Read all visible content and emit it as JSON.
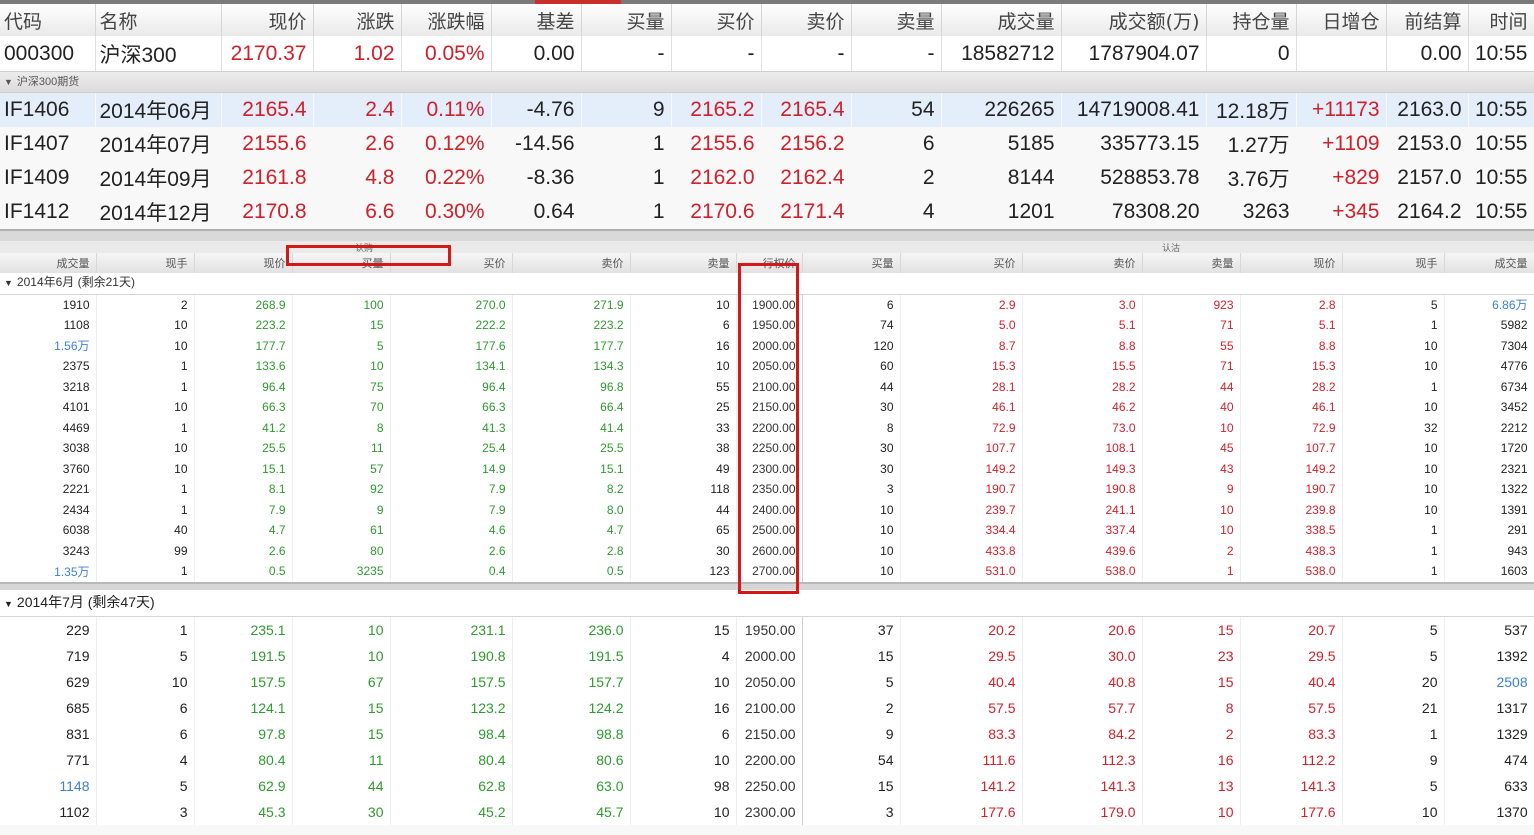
{
  "index_table": {
    "headers": [
      "代码",
      "名称",
      "现价",
      "涨跌",
      "涨跌幅",
      "基差",
      "买量",
      "买价",
      "卖价",
      "卖量",
      "成交量",
      "成交额(万)",
      "持仓量",
      "日增仓",
      "前结算",
      "时间"
    ],
    "row": [
      "000300",
      "沪深300",
      "2170.37",
      "1.02",
      "0.05%",
      "0.00",
      "-",
      "-",
      "-",
      "-",
      "18582712",
      "1787904.07",
      "0",
      "",
      "0.00",
      "10:55"
    ]
  },
  "futures_group_label": "沪深300期货",
  "futures": [
    [
      "IF1406",
      "2014年06月",
      "2165.4",
      "2.4",
      "0.11%",
      "-4.76",
      "9",
      "2165.2",
      "2165.4",
      "54",
      "226265",
      "14719008.41",
      "12.18万",
      "+11173",
      "2163.0",
      "10:55"
    ],
    [
      "IF1407",
      "2014年07月",
      "2155.6",
      "2.6",
      "0.12%",
      "-14.56",
      "1",
      "2155.6",
      "2156.2",
      "6",
      "5185",
      "335773.15",
      "1.27万",
      "+1109",
      "2153.0",
      "10:55"
    ],
    [
      "IF1409",
      "2014年09月",
      "2161.8",
      "4.8",
      "0.22%",
      "-8.36",
      "1",
      "2162.0",
      "2162.4",
      "2",
      "8144",
      "528853.78",
      "3.76万",
      "+829",
      "2157.0",
      "10:55"
    ],
    [
      "IF1412",
      "2014年12月",
      "2170.8",
      "6.6",
      "0.30%",
      "0.64",
      "1",
      "2170.6",
      "2171.4",
      "4",
      "1201",
      "78308.20",
      "3263",
      "+345",
      "2164.2",
      "10:55"
    ]
  ],
  "option_board": {
    "call_title": "认购",
    "put_title": "认沽",
    "headers": [
      "成交量",
      "现手",
      "现价",
      "买量",
      "买价",
      "卖价",
      "卖量",
      "行权价",
      "买量",
      "买价",
      "卖价",
      "卖量",
      "现价",
      "现手",
      "成交量"
    ],
    "june_label": "2014年6月 (剩余21天)",
    "june_rows": [
      [
        "1910",
        "2",
        "268.9",
        "100",
        "270.0",
        "271.9",
        "10",
        "1900.00",
        "6",
        "2.9",
        "3.0",
        "923",
        "2.8",
        "5",
        "6.86万"
      ],
      [
        "1108",
        "10",
        "223.2",
        "15",
        "222.2",
        "223.2",
        "6",
        "1950.00",
        "74",
        "5.0",
        "5.1",
        "71",
        "5.1",
        "1",
        "5982"
      ],
      [
        "1.56万",
        "10",
        "177.7",
        "5",
        "177.6",
        "177.7",
        "16",
        "2000.00",
        "120",
        "8.7",
        "8.8",
        "55",
        "8.8",
        "10",
        "7304"
      ],
      [
        "2375",
        "1",
        "133.6",
        "10",
        "134.1",
        "134.3",
        "10",
        "2050.00",
        "60",
        "15.3",
        "15.5",
        "71",
        "15.3",
        "10",
        "4776"
      ],
      [
        "3218",
        "1",
        "96.4",
        "75",
        "96.4",
        "96.8",
        "55",
        "2100.00",
        "44",
        "28.1",
        "28.2",
        "44",
        "28.2",
        "1",
        "6734"
      ],
      [
        "4101",
        "10",
        "66.3",
        "70",
        "66.3",
        "66.4",
        "25",
        "2150.00",
        "30",
        "46.1",
        "46.2",
        "40",
        "46.1",
        "10",
        "3452"
      ],
      [
        "4469",
        "1",
        "41.2",
        "8",
        "41.3",
        "41.4",
        "33",
        "2200.00",
        "8",
        "72.9",
        "73.0",
        "10",
        "72.9",
        "32",
        "2212"
      ],
      [
        "3038",
        "10",
        "25.5",
        "11",
        "25.4",
        "25.5",
        "38",
        "2250.00",
        "30",
        "107.7",
        "108.1",
        "45",
        "107.7",
        "10",
        "1720"
      ],
      [
        "3760",
        "10",
        "15.1",
        "57",
        "14.9",
        "15.1",
        "49",
        "2300.00",
        "30",
        "149.2",
        "149.3",
        "43",
        "149.2",
        "10",
        "2321"
      ],
      [
        "2221",
        "1",
        "8.1",
        "92",
        "7.9",
        "8.2",
        "118",
        "2350.00",
        "3",
        "190.7",
        "190.8",
        "9",
        "190.7",
        "10",
        "1322"
      ],
      [
        "2434",
        "1",
        "7.9",
        "9",
        "7.9",
        "8.0",
        "44",
        "2400.00",
        "10",
        "239.7",
        "241.1",
        "10",
        "239.8",
        "10",
        "1391"
      ],
      [
        "6038",
        "40",
        "4.7",
        "61",
        "4.6",
        "4.7",
        "65",
        "2500.00",
        "10",
        "334.4",
        "337.4",
        "10",
        "338.5",
        "1",
        "291"
      ],
      [
        "3243",
        "99",
        "2.6",
        "80",
        "2.6",
        "2.8",
        "30",
        "2600.00",
        "10",
        "433.8",
        "439.6",
        "2",
        "438.3",
        "1",
        "943"
      ],
      [
        "1.35万",
        "1",
        "0.5",
        "3235",
        "0.4",
        "0.5",
        "123",
        "2700.00",
        "10",
        "531.0",
        "538.0",
        "1",
        "538.0",
        "1",
        "1603"
      ]
    ],
    "july_label": "2014年7月 (剩余47天)",
    "july_rows": [
      [
        "229",
        "1",
        "235.1",
        "10",
        "231.1",
        "236.0",
        "15",
        "1950.00",
        "37",
        "20.2",
        "20.6",
        "15",
        "20.7",
        "5",
        "537"
      ],
      [
        "719",
        "5",
        "191.5",
        "10",
        "190.8",
        "191.5",
        "4",
        "2000.00",
        "15",
        "29.5",
        "30.0",
        "23",
        "29.5",
        "5",
        "1392"
      ],
      [
        "629",
        "10",
        "157.5",
        "67",
        "157.5",
        "157.7",
        "10",
        "2050.00",
        "5",
        "40.4",
        "40.8",
        "15",
        "40.4",
        "20",
        "2508"
      ],
      [
        "685",
        "6",
        "124.1",
        "15",
        "123.2",
        "124.2",
        "16",
        "2100.00",
        "2",
        "57.5",
        "57.7",
        "8",
        "57.5",
        "21",
        "1317"
      ],
      [
        "831",
        "6",
        "97.8",
        "15",
        "98.4",
        "98.8",
        "6",
        "2150.00",
        "9",
        "83.3",
        "84.2",
        "2",
        "83.3",
        "1",
        "1329"
      ],
      [
        "771",
        "4",
        "80.4",
        "11",
        "80.4",
        "80.6",
        "10",
        "2200.00",
        "54",
        "111.6",
        "112.3",
        "16",
        "112.2",
        "9",
        "474"
      ],
      [
        "1148",
        "5",
        "62.9",
        "44",
        "62.8",
        "63.0",
        "98",
        "2250.00",
        "15",
        "141.2",
        "141.3",
        "13",
        "141.3",
        "5",
        "633"
      ],
      [
        "1102",
        "3",
        "45.3",
        "30",
        "45.2",
        "45.7",
        "10",
        "2300.00",
        "3",
        "177.6",
        "179.0",
        "10",
        "177.6",
        "10",
        "1370"
      ]
    ]
  },
  "colors": {
    "up": "#d0202a",
    "call": "#2f9a2f",
    "highlight": "#3c7fd8",
    "annotation": "#d41818"
  }
}
